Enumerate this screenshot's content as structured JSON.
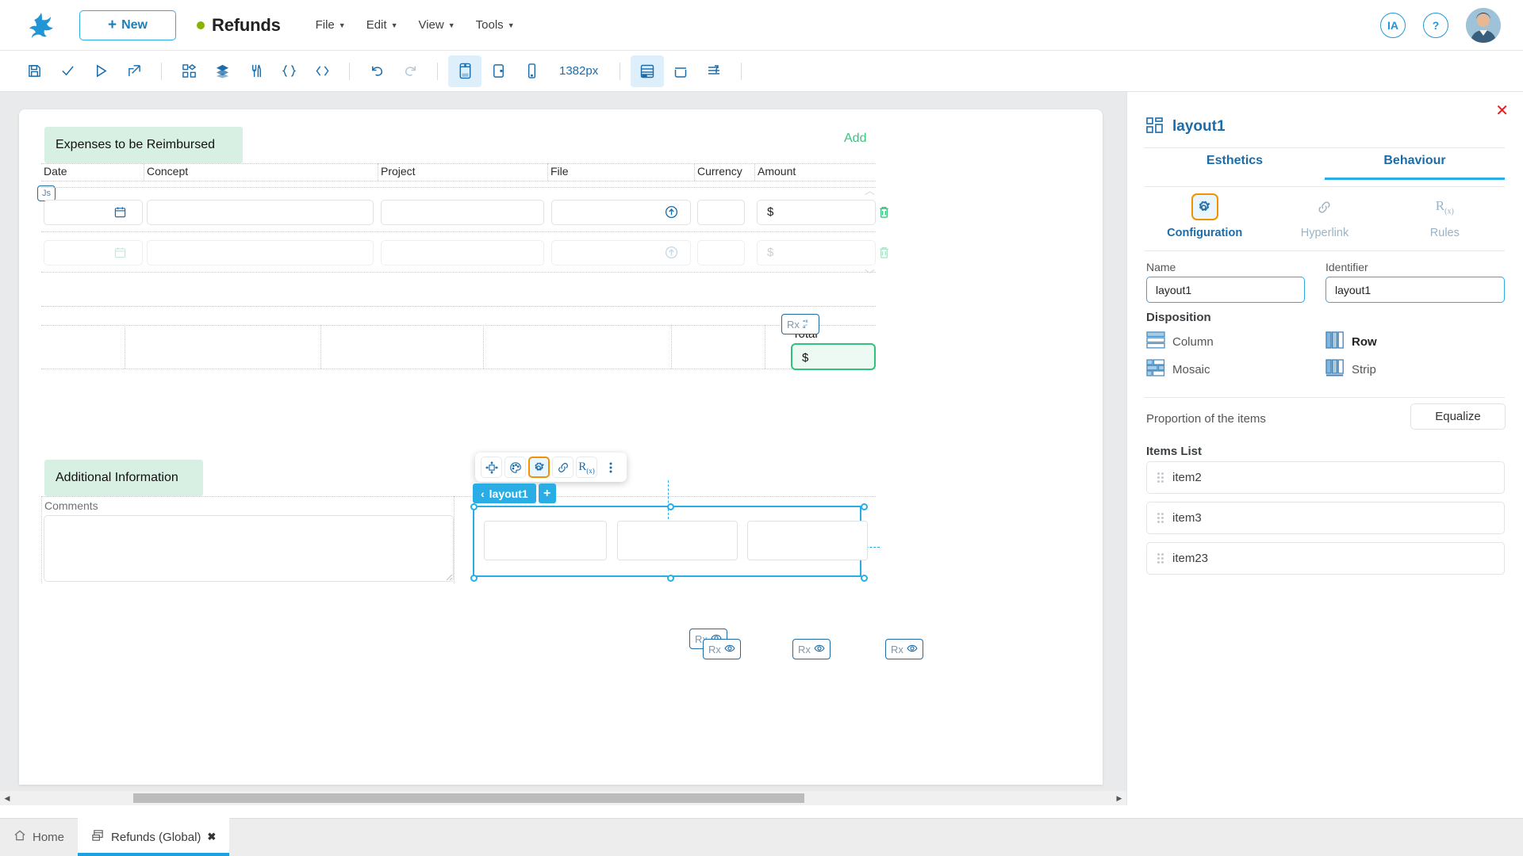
{
  "topbar": {
    "logo_icon": "frog-logo-icon",
    "new_button": {
      "label": "New",
      "icon": "plus-icon"
    },
    "app_title": "Refunds",
    "status_dot_color": "#8ab300",
    "menus": [
      "File",
      "Edit",
      "View",
      "Tools"
    ],
    "ia_button": "IA",
    "help_button": "?",
    "avatar_icon": "user-avatar"
  },
  "toolbar": {
    "zoom_label": "1382px",
    "icons": [
      {
        "name": "save-icon",
        "state": "enabled"
      },
      {
        "name": "validate-check-icon",
        "state": "enabled"
      },
      {
        "name": "run-play-icon",
        "state": "enabled"
      },
      {
        "name": "deploy-export-icon",
        "state": "enabled"
      },
      {
        "name": "components-icon",
        "state": "enabled"
      },
      {
        "name": "layers-icon",
        "state": "enabled"
      },
      {
        "name": "tools-pen-icon",
        "state": "enabled"
      },
      {
        "name": "braces-icon",
        "state": "enabled"
      },
      {
        "name": "code-icon",
        "state": "enabled"
      },
      {
        "name": "undo-icon",
        "state": "enabled"
      },
      {
        "name": "redo-icon",
        "state": "disabled"
      },
      {
        "name": "desktop-view-icon",
        "state": "active"
      },
      {
        "name": "tablet-view-icon",
        "state": "enabled"
      },
      {
        "name": "mobile-view-icon",
        "state": "enabled"
      },
      {
        "name": "grid-layout-icon",
        "state": "enabled"
      },
      {
        "name": "container-icon",
        "state": "enabled"
      },
      {
        "name": "align-icon",
        "state": "enabled"
      }
    ]
  },
  "canvas": {
    "expenses_section": {
      "title": "Expenses to be Reimbursed",
      "add_link": "Add",
      "columns": [
        "Date",
        "Concept",
        "Project",
        "File",
        "Currency",
        "Amount"
      ],
      "rows": [
        {
          "amount_symbol": "$",
          "ghost": false
        },
        {
          "amount_symbol": "$",
          "ghost": true
        }
      ],
      "js_badge": "Js",
      "date_icon": "calendar-icon",
      "file_upload_icon": "upload-icon",
      "delete_icon": "trash-icon"
    },
    "total_section": {
      "label": "Total",
      "value_symbol": "$",
      "rx_badge": "Rx",
      "rx_icon": "formula-icon"
    },
    "additional_section": {
      "title": "Additional Information",
      "comments_label": "Comments"
    },
    "selected_layout": {
      "crumb_label": "layout1",
      "crumb_back_icon": "chevron-left-icon",
      "crumb_add_icon": "plus-icon",
      "sub_items": 3
    },
    "float_toolbar": [
      {
        "name": "move-icon",
        "selected": false
      },
      {
        "name": "palette-icon",
        "selected": false
      },
      {
        "name": "settings-gear-icon",
        "selected": true
      },
      {
        "name": "link-icon",
        "selected": false
      },
      {
        "name": "rules-rx-icon",
        "selected": false
      },
      {
        "name": "more-options-icon",
        "selected": false
      }
    ],
    "rx_visibility_badges": [
      {
        "label": "Rx",
        "icon": "eye-icon"
      },
      {
        "label": "Rx",
        "icon": "eye-icon"
      },
      {
        "label": "Rx",
        "icon": "eye-icon"
      },
      {
        "label": "Rx",
        "icon": "eye-icon"
      }
    ]
  },
  "panel": {
    "title": "layout1",
    "title_icon": "layout-grid-icon",
    "close_icon": "close-icon",
    "tabs": [
      {
        "label": "Esthetics",
        "active": false
      },
      {
        "label": "Behaviour",
        "active": true
      }
    ],
    "subtabs": [
      {
        "label": "Configuration",
        "icon": "settings-gear-icon",
        "selected": true,
        "dim": false
      },
      {
        "label": "Hyperlink",
        "icon": "link-icon",
        "selected": false,
        "dim": true
      },
      {
        "label": "Rules",
        "icon": "rules-rx-icon",
        "selected": false,
        "dim": true
      }
    ],
    "name_label": "Name",
    "name_value": "layout1",
    "identifier_label": "Identifier",
    "identifier_value": "layout1",
    "disposition_header": "Disposition",
    "disposition_options": [
      {
        "label": "Column",
        "icon": "disposition-column-icon",
        "selected": false
      },
      {
        "label": "Row",
        "icon": "disposition-row-icon",
        "selected": true
      },
      {
        "label": "Mosaic",
        "icon": "disposition-mosaic-icon",
        "selected": false
      },
      {
        "label": "Strip",
        "icon": "disposition-strip-icon",
        "selected": false
      }
    ],
    "proportion_label": "Proportion of the items",
    "equalize_label": "Equalize",
    "items_header": "Items List",
    "items": [
      "item2",
      "item3",
      "item23"
    ]
  },
  "bottom_tabs": [
    {
      "label": "Home",
      "icon": "home-icon",
      "active": false,
      "closable": false
    },
    {
      "label": "Refunds (Global)",
      "icon": "form-icon",
      "active": true,
      "closable": true,
      "close_label": "✖"
    }
  ]
}
